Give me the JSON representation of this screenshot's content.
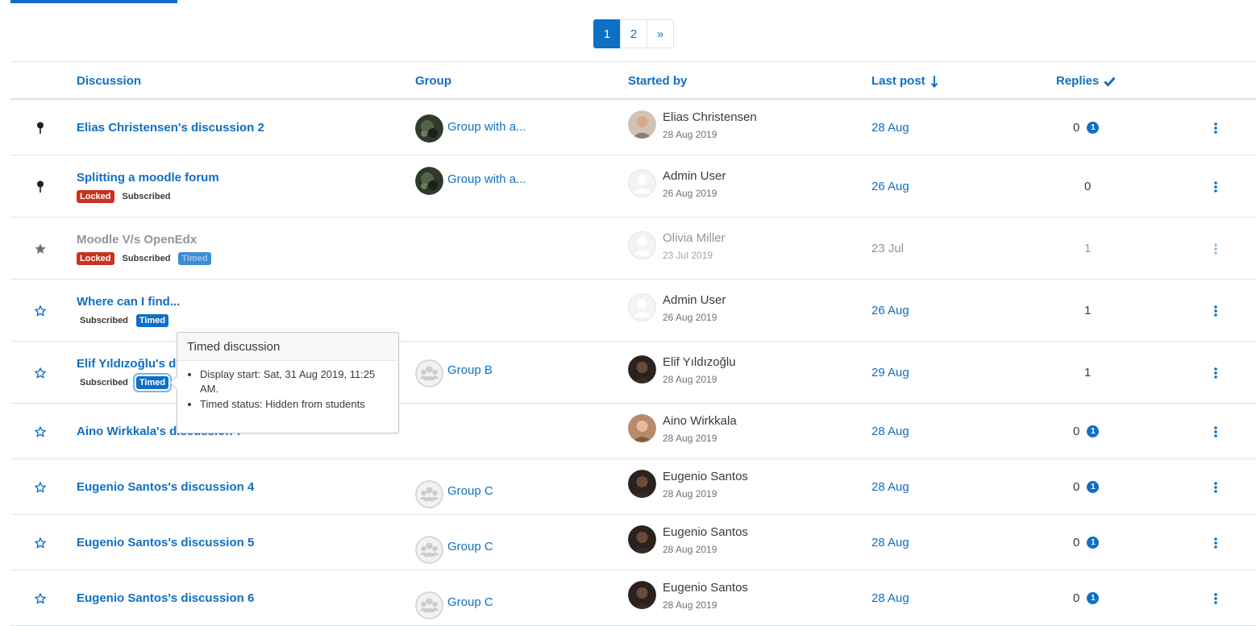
{
  "pagination": {
    "pages": [
      "1",
      "2"
    ],
    "next_label": "»"
  },
  "columns": {
    "discussion": "Discussion",
    "group": "Group",
    "started_by": "Started by",
    "last_post": "Last post",
    "replies": "Replies"
  },
  "rows": [
    {
      "title": "Elias Christensen's discussion 2",
      "marker": "pin",
      "badges": [],
      "group": "Group with a...",
      "group_avatar": "photo",
      "user": "Elias Christensen",
      "user_date": "28 Aug 2019",
      "user_avatar": "photo-light",
      "last_post": "28 Aug",
      "replies": "0",
      "unread": "1",
      "muted": false
    },
    {
      "title": "Splitting a moodle forum",
      "marker": "pin",
      "badges": [
        "Locked",
        "Subscribed"
      ],
      "group": "Group with a...",
      "group_avatar": "photo",
      "user": "Admin User",
      "user_date": "26 Aug 2019",
      "user_avatar": "default",
      "last_post": "26 Aug",
      "replies": "0",
      "unread": "",
      "muted": false
    },
    {
      "title": "Moodle V/s OpenEdx",
      "marker": "star-filled",
      "badges": [
        "Locked",
        "Subscribed",
        "Timed"
      ],
      "group": "",
      "group_avatar": "",
      "user": "Olivia Miller",
      "user_date": "23 Jul 2019",
      "user_avatar": "default",
      "last_post": "23 Jul",
      "replies": "1",
      "unread": "",
      "muted": true
    },
    {
      "title": "Where can I find...",
      "marker": "star-outline",
      "badges": [
        "Subscribed",
        "Timed"
      ],
      "group": "",
      "group_avatar": "",
      "user": "Admin User",
      "user_date": "26 Aug 2019",
      "user_avatar": "default",
      "last_post": "26 Aug",
      "replies": "1",
      "unread": "",
      "muted": false
    },
    {
      "title": "Elif Yıldızoğlu's d",
      "marker": "star-outline",
      "badges": [
        "Subscribed",
        "Timed"
      ],
      "group": "Group B",
      "group_avatar": "group",
      "user": "Elif Yıldızoğlu",
      "user_date": "28 Aug 2019",
      "user_avatar": "photo-dark",
      "last_post": "29 Aug",
      "replies": "1",
      "unread": "",
      "muted": false
    },
    {
      "title": "Aino Wirkkala's discussion 7",
      "marker": "star-outline",
      "badges": [],
      "group": "",
      "group_avatar": "",
      "user": "Aino Wirkkala",
      "user_date": "28 Aug 2019",
      "user_avatar": "photo-warm",
      "last_post": "28 Aug",
      "replies": "0",
      "unread": "1",
      "muted": false
    },
    {
      "title": "Eugenio Santos's discussion 4",
      "marker": "star-outline",
      "badges": [],
      "group": "Group C",
      "group_avatar": "group",
      "user": "Eugenio Santos",
      "user_date": "28 Aug 2019",
      "user_avatar": "photo-dark",
      "last_post": "28 Aug",
      "replies": "0",
      "unread": "1",
      "muted": false
    },
    {
      "title": "Eugenio Santos's discussion 5",
      "marker": "star-outline",
      "badges": [],
      "group": "Group C",
      "group_avatar": "group",
      "user": "Eugenio Santos",
      "user_date": "28 Aug 2019",
      "user_avatar": "photo-dark",
      "last_post": "28 Aug",
      "replies": "0",
      "unread": "1",
      "muted": false
    },
    {
      "title": "Eugenio Santos's discussion 6",
      "marker": "star-outline",
      "badges": [],
      "group": "Group C",
      "group_avatar": "group",
      "user": "Eugenio Santos",
      "user_date": "28 Aug 2019",
      "user_avatar": "photo-dark",
      "last_post": "28 Aug",
      "replies": "0",
      "unread": "1",
      "muted": false
    }
  ],
  "popover": {
    "title": "Timed discussion",
    "items": [
      "Display start: Sat, 31 Aug 2019, 11:25 AM.",
      "Timed status: Hidden from students"
    ]
  },
  "colors": {
    "accent": "#0f6fc5",
    "locked": "#ca3120",
    "border": "#dee2e6",
    "muted_text": "#8f959e"
  }
}
